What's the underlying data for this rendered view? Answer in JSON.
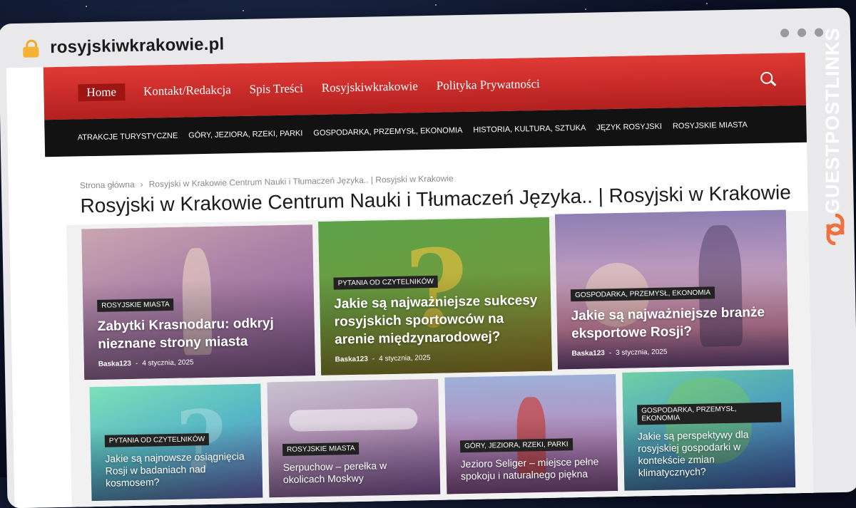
{
  "browser": {
    "url": "rosyjskiwkrakowie.pl"
  },
  "main_nav": [
    {
      "label": "Home",
      "active": true
    },
    {
      "label": "Kontakt/Redakcja"
    },
    {
      "label": "Spis Treści"
    },
    {
      "label": "Rosyjskiwkrakowie"
    },
    {
      "label": "Polityka Prywatności"
    }
  ],
  "category_nav": [
    "ATRAKCJE TURYSTYCZNE",
    "GÓRY, JEZIORA, RZEKI, PARKI",
    "GOSPODARKA, PRZEMYSŁ, EKONOMIA",
    "HISTORIA, KULTURA, SZTUKA",
    "JĘZYK ROSYJSKI",
    "ROSYJSKIE MIASTA"
  ],
  "breadcrumb": {
    "home": "Strona główna",
    "current": "Rosyjski w Krakowie Centrum Nauki i Tłumaczeń Języka.. | Rosyjski w Krakowie"
  },
  "page_title": "Rosyjski w Krakowie Centrum Nauki i Tłumaczeń Języka.. | Rosyjski w Krakowie",
  "featured": [
    {
      "tag": "ROSYJSKIE MIASTA",
      "title": "Zabytki Krasnodaru: odkryj nieznane strony miasta",
      "author": "Baska123",
      "date": "4 stycznia, 2025"
    },
    {
      "tag": "PYTANIA OD CZYTELNIKÓW",
      "title": "Jakie są najważniejsze sukcesy rosyjskich sportowców na arenie międzynarodowej?",
      "author": "Baska123",
      "date": "4 stycznia, 2025"
    },
    {
      "tag": "GOSPODARKA, PRZEMYSŁ, EKONOMIA",
      "title": "Jakie są najważniejsze branże eksportowe Rosji?",
      "author": "Baska123",
      "date": "3 stycznia, 2025"
    }
  ],
  "secondary": [
    {
      "tag": "PYTANIA OD CZYTELNIKÓW",
      "title": "Jakie są najnowsze osiągnięcia Rosji w badaniach nad kosmosem?"
    },
    {
      "tag": "ROSYJSKIE MIASTA",
      "title": "Serpuchow – perełka w okolicach Moskwy"
    },
    {
      "tag": "GÓRY, JEZIORA, RZEKI, PARKI",
      "title": "Jezioro Seliger – miejsce pełne spokoju i naturalnego piękna"
    },
    {
      "tag": "GOSPODARKA, PRZEMYSŁ, EKONOMIA",
      "title": "Jakie są perspektywy dla rosyjskiej gospodarki w kontekście zmian klimatycznych?"
    }
  ],
  "badge": {
    "text": "GUESTPOSTLINKS"
  }
}
